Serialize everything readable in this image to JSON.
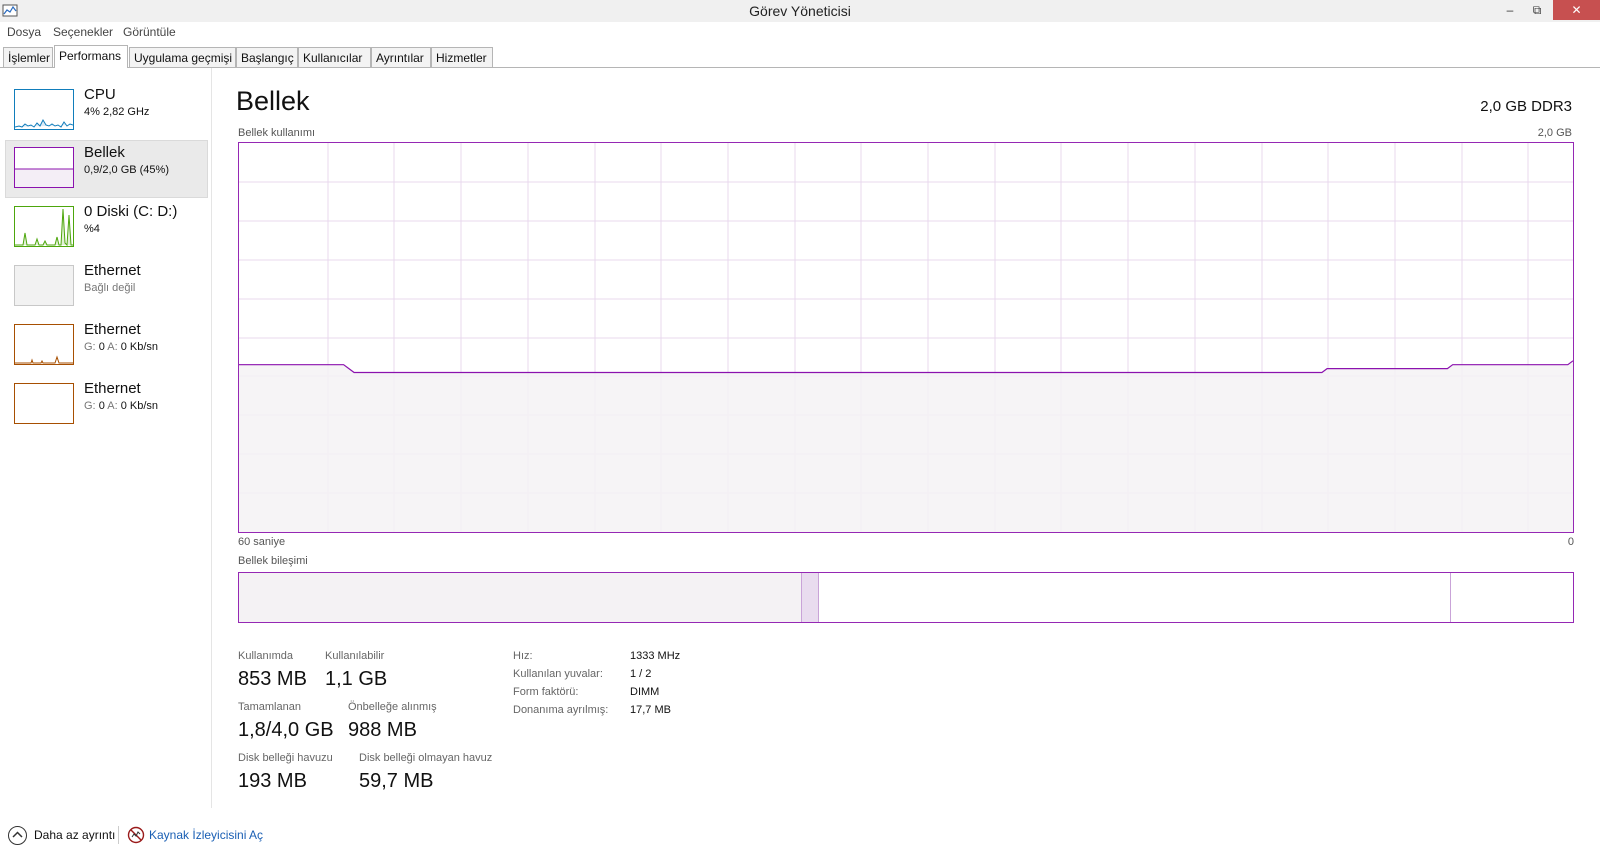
{
  "window": {
    "title": "Görev Yöneticisi",
    "minimize": "–",
    "restore": "⧉",
    "close": "✕"
  },
  "menu": [
    "Dosya",
    "Seçenekler",
    "Görüntüle"
  ],
  "tabs": [
    {
      "label": "İşlemler",
      "active": false
    },
    {
      "label": "Performans",
      "active": true
    },
    {
      "label": "Uygulama geçmişi",
      "active": false
    },
    {
      "label": "Başlangıç",
      "active": false
    },
    {
      "label": "Kullanıcılar",
      "active": false
    },
    {
      "label": "Ayrıntılar",
      "active": false
    },
    {
      "label": "Hizmetler",
      "active": false
    }
  ],
  "sidebar": [
    {
      "name": "CPU",
      "sub": "4% 2,82 GHz",
      "color": "#117dbb"
    },
    {
      "name": "Bellek",
      "sub": "0,9/2,0 GB (45%)",
      "color": "#8b12ae",
      "selected": true
    },
    {
      "name": "0 Diski (C: D:)",
      "sub": "%4",
      "color": "#4da60c"
    },
    {
      "name": "Ethernet",
      "sub": "Bağlı değil",
      "color": "#a0a0a0"
    },
    {
      "name": "Ethernet",
      "sub_s_label": "G:",
      "sub_s_val": "0",
      "sub_r_label": "A:",
      "sub_r_val": "0 Kb/sn",
      "color": "#a74f01"
    },
    {
      "name": "Ethernet",
      "sub_s_label": "G:",
      "sub_s_val": "0",
      "sub_r_label": "A:",
      "sub_r_val": "0 Kb/sn",
      "color": "#a74f01"
    }
  ],
  "main": {
    "title": "Bellek",
    "memory_type": "2,0 GB DDR3",
    "usage_label": "Bellek kullanımı",
    "usage_max": "2,0 GB",
    "time_left": "60 saniye",
    "time_right": "0",
    "composition_label": "Bellek bileşimi",
    "usage_history_pct": [
      43,
      43,
      43,
      43,
      43,
      43,
      43,
      43,
      43,
      43,
      43,
      43,
      43,
      43,
      43,
      43,
      43,
      43,
      43,
      43,
      43,
      42,
      41,
      41,
      41,
      41,
      41,
      41,
      41,
      41,
      41,
      41,
      41,
      41,
      41,
      41,
      41,
      41,
      41,
      41,
      41,
      41,
      41,
      41,
      41,
      41,
      41,
      41,
      41,
      41,
      41,
      41,
      41,
      41,
      41,
      41,
      41,
      41,
      41,
      41,
      41,
      41,
      41,
      41,
      41,
      41,
      41,
      41,
      41,
      41,
      41,
      41,
      41,
      41,
      41,
      41,
      41,
      41,
      41,
      41,
      41,
      41,
      41,
      41,
      41,
      41,
      41,
      41,
      41,
      41,
      41,
      41,
      41,
      41,
      41,
      41,
      41,
      41,
      41,
      41,
      41,
      41,
      41,
      41,
      41,
      41,
      41,
      41,
      41,
      41,
      41,
      41,
      41,
      41,
      41,
      41,
      41,
      41,
      41,
      41,
      41,
      41,
      41,
      41,
      41,
      41,
      41,
      41,
      41,
      41,
      41,
      41,
      41,
      41,
      41,
      41,
      41,
      41,
      41,
      41,
      41,
      41,
      41,
      41,
      41,
      41,
      41,
      41,
      41,
      41,
      41,
      41,
      41,
      41,
      41,
      41,
      41,
      41,
      41,
      41,
      41,
      41,
      41,
      41,
      41,
      41,
      41,
      41,
      41,
      41,
      41,
      41,
      41,
      41,
      41,
      41,
      41,
      41,
      41,
      41,
      41,
      41,
      41,
      41,
      41,
      41,
      41,
      41,
      41,
      41,
      41,
      41,
      41,
      41,
      41,
      41,
      41,
      41,
      41,
      41,
      41,
      41,
      41,
      41,
      41,
      41,
      41,
      41,
      42,
      42,
      42,
      42,
      42,
      42,
      42,
      42,
      42,
      42,
      42,
      42,
      42,
      42,
      42,
      42,
      42,
      42,
      42,
      42,
      42,
      42,
      42,
      42,
      43,
      43,
      43,
      43,
      43,
      43,
      43,
      43,
      43,
      43,
      43,
      43,
      43,
      43,
      43,
      43,
      43,
      43,
      43,
      43,
      43,
      43,
      43,
      44
    ],
    "composition": {
      "in_use_frac": 0.422,
      "modified_frac": 0.013,
      "standby_frac": 0.474,
      "free_frac": 0.091
    },
    "stats": {
      "in_use_label": "Kullanımda",
      "in_use": "853 MB",
      "available_label": "Kullanılabilir",
      "available": "1,1 GB",
      "committed_label": "Tamamlanan",
      "committed": "1,8/4,0 GB",
      "cached_label": "Önbelleğe alınmış",
      "cached": "988 MB",
      "paged_label": "Disk belleği havuzu",
      "paged": "193 MB",
      "nonpaged_label": "Disk belleği olmayan havuz",
      "nonpaged": "59,7 MB"
    },
    "specs": [
      {
        "label": "Hız:",
        "value": "1333 MHz"
      },
      {
        "label": "Kullanılan yuvalar:",
        "value": "1 / 2"
      },
      {
        "label": "Form faktörü:",
        "value": "DIMM"
      },
      {
        "label": "Donanıma ayrılmış:",
        "value": "17,7 MB"
      }
    ]
  },
  "footer": {
    "fewer_details": "Daha az ayrıntı",
    "open_resmon": "Kaynak İzleyicisini Aç"
  },
  "colors": {
    "memory": "#8b12ae",
    "memory_fill": "#f4f2f4",
    "grid": "#e8d8ee",
    "link": "#1a5fb4"
  }
}
